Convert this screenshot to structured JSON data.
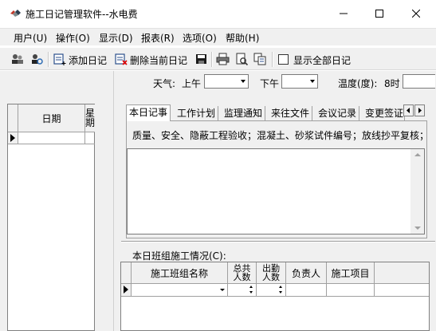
{
  "window": {
    "title": "施工日记管理软件--水电费",
    "controls": {
      "minimize": "minimize-icon",
      "maximize": "maximize-icon",
      "close": "close-icon"
    }
  },
  "menu": {
    "items": [
      {
        "label": "用户(U)"
      },
      {
        "label": "操作(O)"
      },
      {
        "label": "显示(D)"
      },
      {
        "label": "报表(R)"
      },
      {
        "label": "选项(O)"
      },
      {
        "label": "帮助(H)"
      }
    ]
  },
  "toolbar": {
    "add_diary": "添加日记",
    "delete_diary": "删除当前日记",
    "show_all": "显示全部日记",
    "show_all_checked": false
  },
  "date_list": {
    "col_date": "日期",
    "col_week": "星期"
  },
  "weather": {
    "label": "天气:",
    "morning_label": "上午",
    "morning_value": "",
    "afternoon_label": "下午",
    "afternoon_value": "",
    "temperature_label": "温度(度):",
    "time_label": "8时",
    "temperature_value": ""
  },
  "tabs": [
    {
      "label": "本日记事",
      "active": true
    },
    {
      "label": "工作计划",
      "active": false
    },
    {
      "label": "监理通知",
      "active": false
    },
    {
      "label": "来往文件",
      "active": false
    },
    {
      "label": "会议记录",
      "active": false
    },
    {
      "label": "变更签证",
      "active": false
    }
  ],
  "diary": {
    "check_items": "质量、安全、隐蔽工程验收；混凝土、砂浆试件编号；放线抄平复核；",
    "notes": ""
  },
  "crew": {
    "label": "本日班组施工情况(C):",
    "columns": {
      "team_name": "施工班组名称",
      "total_1": "总共",
      "total_2": "人数",
      "present_1": "出勤",
      "present_2": "人数",
      "leader": "负责人",
      "project": "施工项目"
    }
  }
}
